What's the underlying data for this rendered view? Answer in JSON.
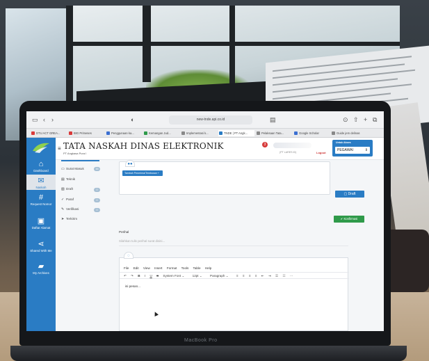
{
  "browser": {
    "url": "new-tnde.api.co.id",
    "tabs": [
      {
        "label": "DTU ACT GREA...",
        "color": "#d93a3a"
      },
      {
        "label": "BIG Primeses",
        "color": "#d93a3a"
      },
      {
        "label": "Penggunaan ka...",
        "color": "#3b6fd1"
      },
      {
        "label": "Kemangan Jud...",
        "color": "#2e9a4a"
      },
      {
        "label": "Implementasi k...",
        "color": "#888888"
      },
      {
        "label": "TNDE | PT Angk...",
        "color": "#2a7cc4"
      },
      {
        "label": "Pelaksaan Tata...",
        "color": "#888888"
      },
      {
        "label": "Google Scholar",
        "color": "#3b6fd1"
      },
      {
        "label": "Guide jem delinas",
        "color": "#888888"
      }
    ]
  },
  "app": {
    "title": "TATA NASKAH DINAS ELEKTRONIK",
    "subtitle": "PT Angkasa Pura I",
    "notification_count": "3",
    "user_sub": "(PT LARES ID)",
    "logout": "Logout",
    "role_label": "Untuk Akses",
    "role_value": "PEGAWAI"
  },
  "sidebar": {
    "items": [
      {
        "label": "Dashboard",
        "icon": "home-icon"
      },
      {
        "label": "Naskah",
        "icon": "envelope-icon"
      },
      {
        "label": "Request Nomor",
        "icon": "hash-icon"
      },
      {
        "label": "Daftar Alamat",
        "icon": "contact-icon"
      },
      {
        "label": "Shared With Me",
        "icon": "share-icon"
      },
      {
        "label": "My Archives",
        "icon": "folder-icon"
      }
    ]
  },
  "menu": {
    "items": [
      {
        "label": "Surat Masuk",
        "badge": "16"
      },
      {
        "label": "Teknik",
        "badge": ""
      },
      {
        "label": "Draft",
        "badge": "0"
      },
      {
        "label": "Paraf",
        "badge": "0"
      },
      {
        "label": "Verifikasi",
        "badge": "0"
      },
      {
        "label": "Terkirim",
        "badge": ""
      }
    ]
  },
  "form": {
    "add_button": "Tambah Penerima/Tembusan +",
    "draft_button": "Draft",
    "konfirmasi_button": "Konfirmasi",
    "perihal_label": "Perihal",
    "perihal_placeholder": "Silahkan tulis perihal surat disini..."
  },
  "editor": {
    "menu": [
      "File",
      "Edit",
      "View",
      "Insert",
      "Format",
      "Tools",
      "Table",
      "Help"
    ],
    "font": "System Font",
    "size": "12pt",
    "block": "Paragraph",
    "body": "isi pesan..."
  },
  "laptop": {
    "brand": "MacBook Pro"
  }
}
